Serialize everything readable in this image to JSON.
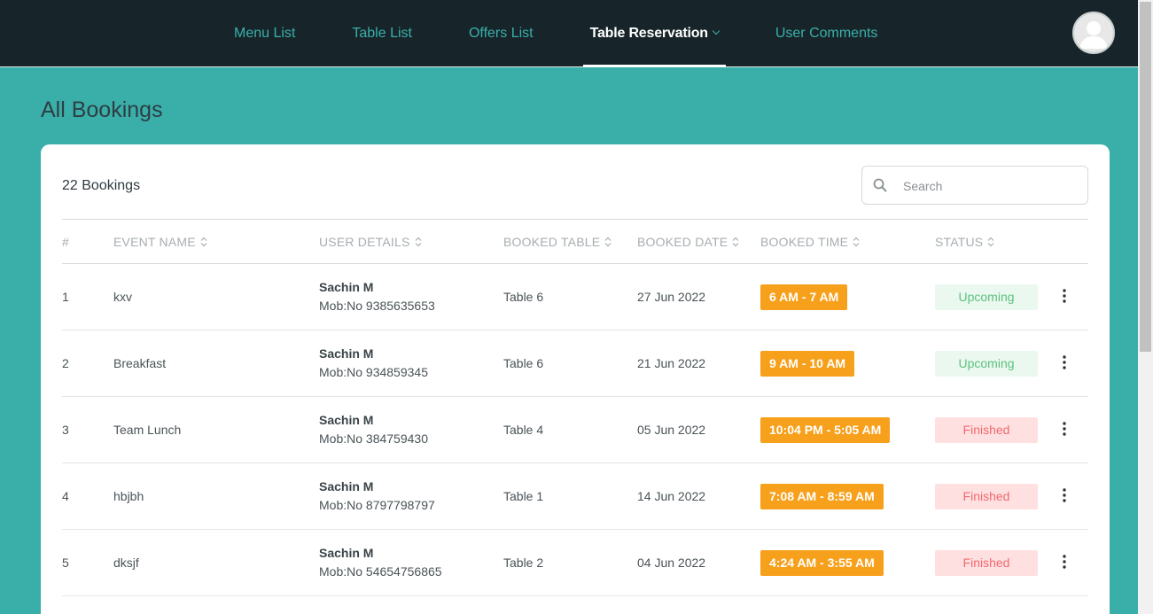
{
  "nav": {
    "items": [
      {
        "label": "Menu List"
      },
      {
        "label": "Table List"
      },
      {
        "label": "Offers List"
      },
      {
        "label": "Table Reservation"
      },
      {
        "label": "User Comments"
      }
    ],
    "active": "Table Reservation"
  },
  "page": {
    "title": "All Bookings"
  },
  "bookings": {
    "count_label": "22 Bookings",
    "search_placeholder": "Search",
    "columns": [
      "#",
      "EVENT NAME",
      "USER DETAILS",
      "BOOKED TABLE",
      "BOOKED DATE",
      "BOOKED TIME",
      "STATUS"
    ],
    "rows": [
      {
        "index": "1",
        "event": "kxv",
        "user_name": "Sachin M",
        "mobile": "Mob:No 9385635653",
        "table": "Table 6",
        "date": "27 Jun 2022",
        "time": "6 AM - 7 AM",
        "status": "Upcoming"
      },
      {
        "index": "2",
        "event": "Breakfast",
        "user_name": "Sachin M",
        "mobile": "Mob:No 934859345",
        "table": "Table 6",
        "date": "21 Jun 2022",
        "time": "9 AM - 10 AM",
        "status": "Upcoming"
      },
      {
        "index": "3",
        "event": "Team Lunch",
        "user_name": "Sachin M",
        "mobile": "Mob:No 384759430",
        "table": "Table 4",
        "date": "05 Jun 2022",
        "time": "10:04 PM - 5:05 AM",
        "status": "Finished"
      },
      {
        "index": "4",
        "event": "hbjbh",
        "user_name": "Sachin M",
        "mobile": "Mob:No 8797798797",
        "table": "Table 1",
        "date": "14 Jun 2022",
        "time": "7:08 AM - 8:59 AM",
        "status": "Finished"
      },
      {
        "index": "5",
        "event": "dksjf",
        "user_name": "Sachin M",
        "mobile": "Mob:No 54654756865",
        "table": "Table 2",
        "date": "04 Jun 2022",
        "time": "4:24 AM - 3:55 AM",
        "status": "Finished"
      }
    ]
  },
  "colors": {
    "navbar": "#17252a",
    "accent": "#3aafa9",
    "time_badge": "#f7a01b",
    "upcoming_bg": "#eaf8ef",
    "upcoming_text": "#5cc27e",
    "finished_bg": "#ffe0e1",
    "finished_text": "#f0696f"
  },
  "icons": {
    "avatar": "user-avatar-icon",
    "search": "search-icon",
    "sort": "sort-icon",
    "row_menu": "more-vertical-icon",
    "dropdown": "chevron-down-icon"
  }
}
